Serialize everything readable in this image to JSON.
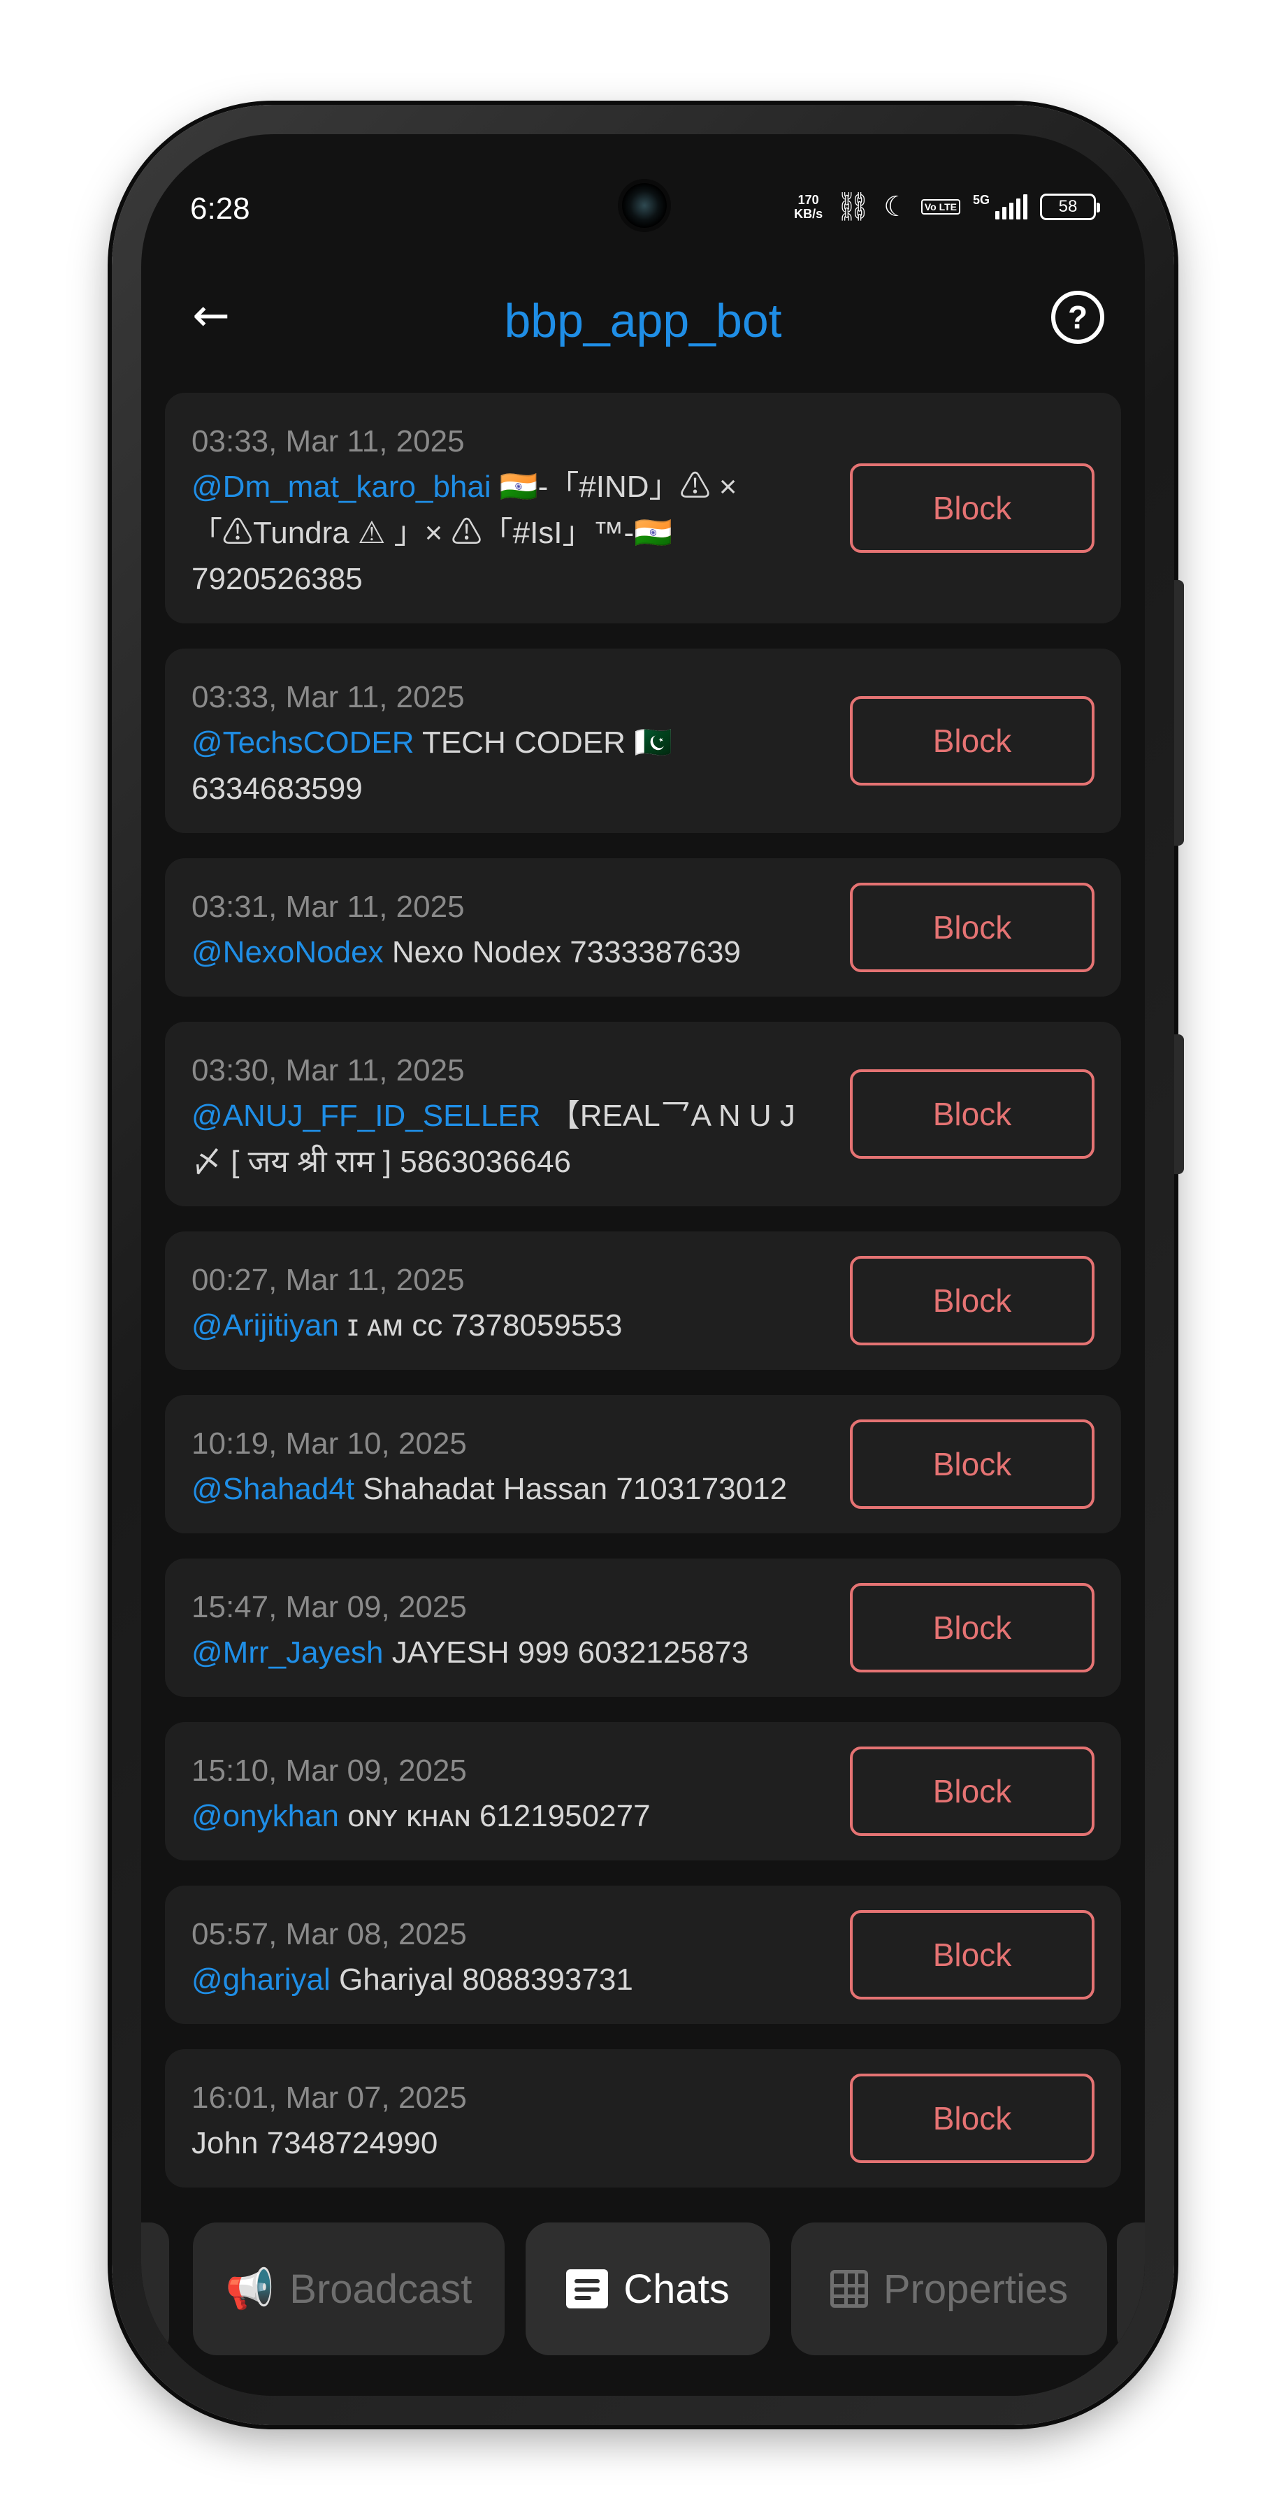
{
  "status_bar": {
    "time": "6:28",
    "speed_value": "170",
    "speed_unit": "KB/s",
    "network": "5G",
    "volte": "Vo LTE",
    "battery": "58"
  },
  "header": {
    "title": "bbp_app_bot",
    "back_icon": "arrow-left-icon",
    "help_icon": "help-circle-icon"
  },
  "chats": [
    {
      "time": "03:33, Mar 11, 2025",
      "username": "@Dm_mat_karo_bhai",
      "name": "🇮🇳-「#IND」⚠ ×「⚠Tundra ⚠ 」× ⚠「#IsI」™-🇮🇳",
      "id": "7920526385",
      "block_label": "Block"
    },
    {
      "time": "03:33, Mar 11, 2025",
      "username": "@TechsCODER",
      "name": "TECH CODER 🇵🇰",
      "id": "6334683599",
      "block_label": "Block"
    },
    {
      "time": "03:31, Mar 11, 2025",
      "username": "@NexoNodex",
      "name": "Nexo Nodex",
      "id": "7333387639",
      "block_label": "Block"
    },
    {
      "time": "03:30, Mar 11, 2025",
      "username": "@ANUJ_FF_ID_SELLER",
      "name": "【REAL乛A N U J〆 [ जय श्री राम ]",
      "id": "5863036646",
      "block_label": "Block"
    },
    {
      "time": "00:27, Mar 11, 2025",
      "username": "@Arijitiyan",
      "name": "ɪ ᴀᴍ ᴄᴄ",
      "id": "7378059553",
      "block_label": "Block"
    },
    {
      "time": "10:19, Mar 10, 2025",
      "username": "@Shahad4t",
      "name": "Shahadat Hassan",
      "id": "7103173012",
      "block_label": "Block"
    },
    {
      "time": "15:47, Mar 09, 2025",
      "username": "@Mrr_Jayesh",
      "name": "JAYESH 999",
      "id": "6032125873",
      "block_label": "Block"
    },
    {
      "time": "15:10, Mar 09, 2025",
      "username": "@onykhan",
      "name": "ᴏɴʏ ᴋʜᴀɴ",
      "id": "6121950277",
      "block_label": "Block"
    },
    {
      "time": "05:57, Mar 08, 2025",
      "username": "@ghariyal",
      "name": "Ghariyal",
      "id": "8088393731",
      "block_label": "Block"
    },
    {
      "time": "16:01, Mar 07, 2025",
      "username": "",
      "name": "John",
      "id": "7348724990",
      "block_label": "Block"
    }
  ],
  "bottom_nav": {
    "broadcast_label": "Broadcast",
    "chats_label": "Chats",
    "properties_label": "Properties",
    "active": "Chats"
  },
  "colors": {
    "accent": "#1f8ee6",
    "block": "#e57373",
    "background": "#121212",
    "card": "#1f1f1f"
  }
}
